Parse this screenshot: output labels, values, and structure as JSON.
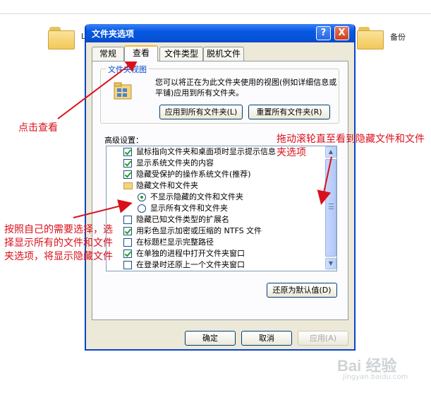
{
  "background": {
    "folders": [
      {
        "label": ""
      },
      {
        "label": "备份"
      }
    ],
    "partial_label": "L"
  },
  "dialog": {
    "title": "文件夹选项",
    "help_glyph": "?",
    "close_glyph": "X",
    "tabs": [
      {
        "label": "常规",
        "active": false
      },
      {
        "label": "查看",
        "active": true
      },
      {
        "label": "文件类型",
        "active": false
      },
      {
        "label": "脱机文件",
        "active": false
      }
    ],
    "folder_views": {
      "group_label": "文件夹视图",
      "description": "您可以将正在为此文件夹使用的视图(例如详细信息或平铺)应用到所有文件夹。",
      "apply_all_button": "应用到所有文件夹(L)",
      "reset_all_button": "重置所有文件夹(R)"
    },
    "advanced_label": "高级设置：",
    "advanced_items": [
      {
        "type": "checkbox",
        "checked": true,
        "label": "鼠标指向文件夹和桌面项时显示提示信息"
      },
      {
        "type": "checkbox",
        "checked": true,
        "label": "显示系统文件夹的内容"
      },
      {
        "type": "checkbox",
        "checked": true,
        "label": "隐藏受保护的操作系统文件(推荐)"
      },
      {
        "type": "folder",
        "label": "隐藏文件和文件夹"
      },
      {
        "type": "radio",
        "checked": true,
        "label": "不显示隐藏的文件和文件夹"
      },
      {
        "type": "radio",
        "checked": false,
        "label": "显示所有文件和文件夹"
      },
      {
        "type": "checkbox",
        "checked": false,
        "label": "隐藏已知文件类型的扩展名"
      },
      {
        "type": "checkbox",
        "checked": true,
        "label": "用彩色显示加密或压缩的 NTFS 文件"
      },
      {
        "type": "checkbox",
        "checked": false,
        "label": "在标题栏显示完整路径"
      },
      {
        "type": "checkbox",
        "checked": true,
        "label": "在单独的进程中打开文件夹窗口"
      },
      {
        "type": "checkbox",
        "checked": false,
        "label": "在登录时还原上一个文件夹窗口"
      }
    ],
    "restore_defaults_button": "还原为默认值(D)",
    "ok_button": "确定",
    "cancel_button": "取消",
    "apply_button": "应用(A)"
  },
  "annotations": {
    "click_view": "点击查看",
    "scroll_note": "拖动滚轮直至看到隐藏文件和文件夹选项",
    "choose_note": "按照自己的需要选择，选择显示所有的文件和文件夹选项，将显示隐藏文件",
    "arrow_color": "#d9101b"
  },
  "watermark": {
    "text": "Bai 经验",
    "sub": "jingyan.baidu.com"
  }
}
